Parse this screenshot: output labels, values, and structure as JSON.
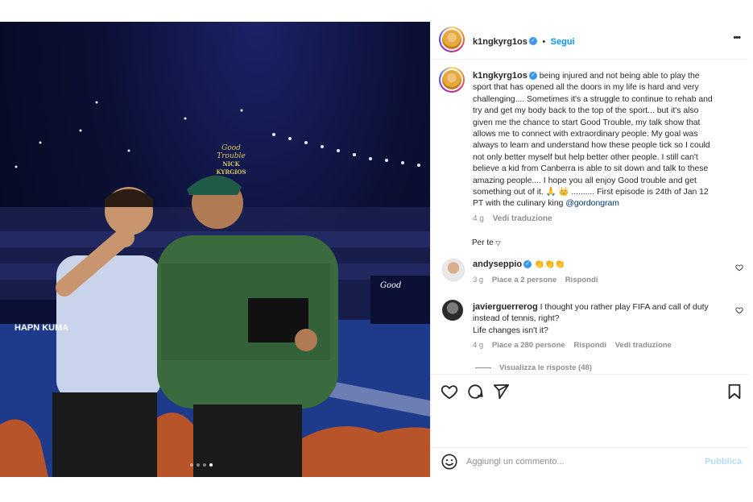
{
  "post": {
    "username": "k1ngkyrg1os",
    "follow_label": "Segui",
    "more_label": "•••",
    "caption_lines": [
      "being injured and not being able to play the",
      "sport that has opened all the doors in my life is hard and very",
      "challenging.... Sometimes it's a struggle to continue to rehab and",
      "try and get my body back to the top of the sport... but it's also",
      "given me the chance to start Good Trouble, my talk show that",
      "allows me to connect with extraordinary people. My goal was",
      "always to learn and understand how these people tick so I could",
      "not only better myself but help better other people. I still can't",
      "believe a kid from Canberra is able to sit down and talk to these",
      "amazing people.... I hope you all enjoy Good trouble and get",
      "something out of it. 🙏 👑 .......... First episode is 24th of Jan 12",
      "PT with the culinary king"
    ],
    "caption_mention": "@gordongram",
    "caption_time": "4 g",
    "translate_label": "Vedi traduzione",
    "for_you_label": "Per te",
    "media_sign_title": "Good Trouble",
    "media_sign_sub": "NICK KYRGIOS",
    "media_banner_left": "HAPN KUMA",
    "media_banner_right": "Good",
    "carousel_dots": 4,
    "carousel_active": 4
  },
  "comments": [
    {
      "username": "andyseppio",
      "verified": true,
      "text": "👏👏👏",
      "time": "3 g",
      "likes": "Piace a 2 persone",
      "reply_label": "Rispondi",
      "translate_label": ""
    },
    {
      "username": "javierguerrerog",
      "verified": false,
      "text_lines": [
        "I thought you rather play FIFA and call of duty",
        "instead of tennis, right?",
        "Life changes isn't it?"
      ],
      "time": "4 g",
      "likes": "Piace a 280 persone",
      "reply_label": "Rispondi",
      "translate_label": "Vedi traduzione",
      "view_replies": "Visualizza le risposte (48)"
    }
  ],
  "composer": {
    "placeholder": "Aggiungi un commento...",
    "publish_label": "Pubblica"
  },
  "colors": {
    "accent": "#0095f6",
    "verified": "#3897f0",
    "muted": "#8e8e8e",
    "mention": "#00376b"
  },
  "icons": [
    "like-icon",
    "comment-icon",
    "share-icon",
    "save-icon",
    "emoji-icon",
    "heart-outline-icon",
    "chevron-down-icon",
    "more-icon"
  ]
}
